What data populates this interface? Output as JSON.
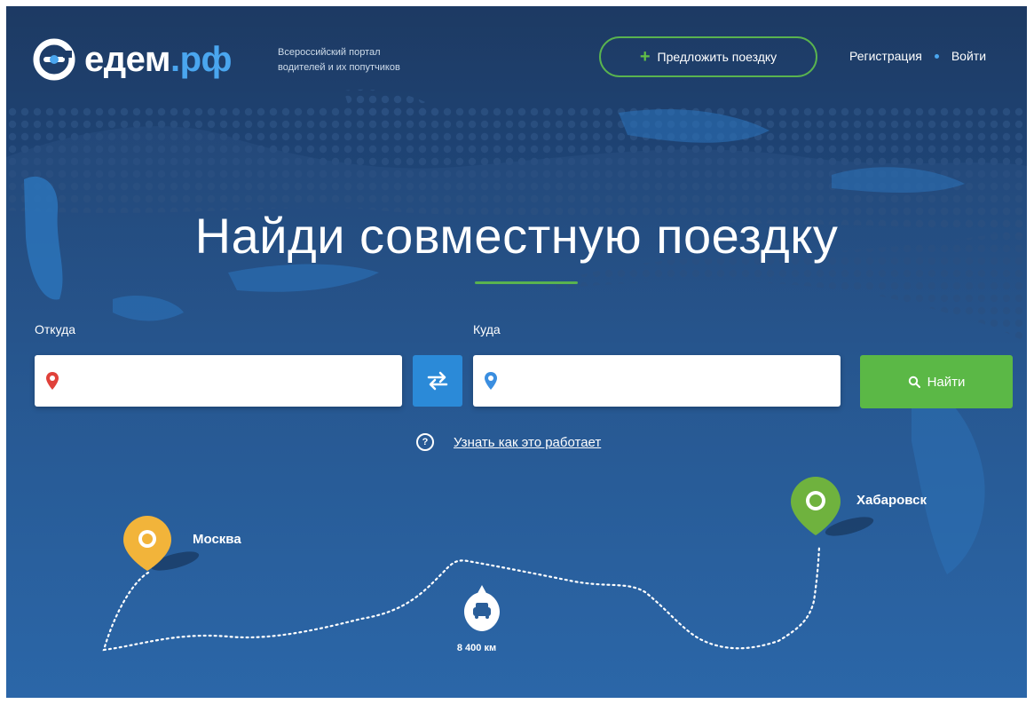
{
  "header": {
    "logo_main": "едем",
    "logo_tld": ".рф",
    "tagline_line1": "Всероссийский портал",
    "tagline_line2": "водителей и их попутчиков",
    "propose_button": "Предложить поездку",
    "register_link": "Регистрация",
    "login_link": "Войти"
  },
  "hero": {
    "title": "Найди совместную поездку"
  },
  "search": {
    "from_label": "Откуда",
    "from_value": "",
    "to_label": "Куда",
    "to_value": "",
    "submit_label": "Найти",
    "how_it_works_link": "Узнать как это работает"
  },
  "route": {
    "origin_city": "Москва",
    "destination_city": "Хабаровск",
    "distance": "8 400 км"
  },
  "colors": {
    "brand_blue": "#4aa6ef",
    "accent_green": "#5bb846",
    "origin_pin": "#f2b43a",
    "destination_pin": "#6fb23e",
    "from_pin": "#e0413a",
    "to_pin": "#3a8ee0"
  },
  "icons": [
    "logo-mark-icon",
    "plus-icon",
    "location-pin-icon",
    "swap-arrows-icon",
    "search-icon",
    "question-icon",
    "car-icon"
  ]
}
